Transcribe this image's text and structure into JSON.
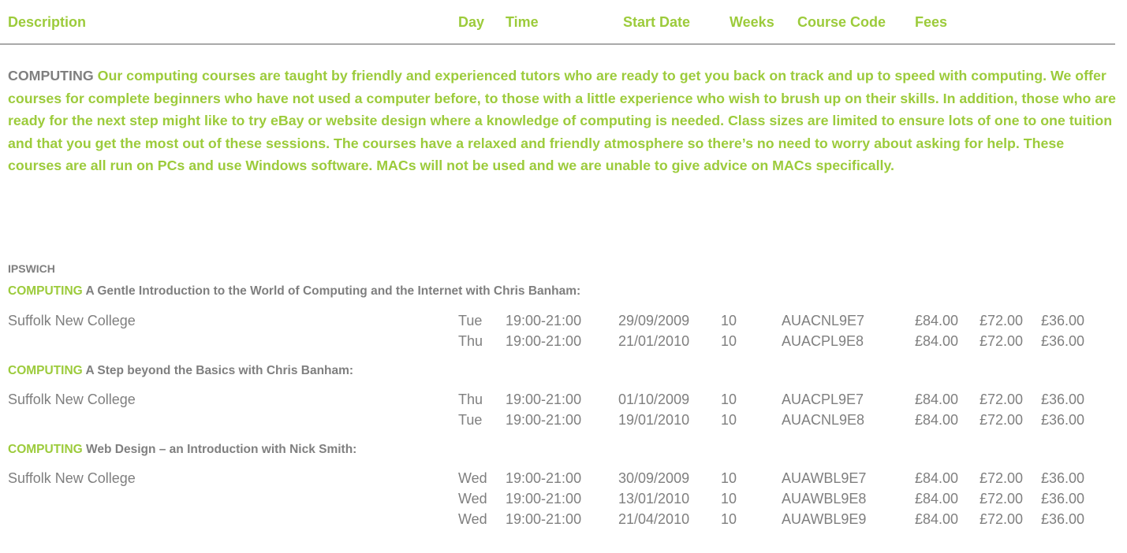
{
  "headers": {
    "description": "Description",
    "day": "Day",
    "time": "Time",
    "start_date": "Start Date",
    "weeks": "Weeks",
    "course_code": "Course Code",
    "fees": "Fees"
  },
  "intro": {
    "category": "COMPUTING",
    "text": "Our computing courses are taught by friendly and experienced tutors who are ready to get you back on track and up to speed with computing. We offer courses for complete beginners who have not used a computer before, to those with a little experience who wish to brush up on their skills. In addition, those who are ready for the next step might like to try eBay or website design where a knowledge of computing is needed. Class sizes are limited to ensure lots of one to one tuition and that you get the most out of these sessions. The courses have a relaxed and friendly atmosphere so there’s no need to worry about asking for help. These courses are all run on PCs and use Windows software. MACs will not be used and we are unable to give advice on MACs specifically."
  },
  "region": "IPSWICH",
  "courses": [
    {
      "category": "COMPUTING",
      "title": "A Gentle Introduction to the World of Computing and the Internet with Chris Banham:",
      "venue": "Suffolk New College",
      "sessions": [
        {
          "day": "Tue",
          "time": "19:00-21:00",
          "start_date": "29/09/2009",
          "weeks": "10",
          "code": "AUACNL9E7",
          "fee1": "£84.00",
          "fee2": "£72.00",
          "fee3": "£36.00"
        },
        {
          "day": "Thu",
          "time": "19:00-21:00",
          "start_date": "21/01/2010",
          "weeks": "10",
          "code": "AUACPL9E8",
          "fee1": "£84.00",
          "fee2": "£72.00",
          "fee3": "£36.00"
        }
      ]
    },
    {
      "category": "COMPUTING",
      "title": "A Step beyond the Basics with Chris Banham:",
      "venue": "Suffolk New College",
      "sessions": [
        {
          "day": "Thu",
          "time": "19:00-21:00",
          "start_date": "01/10/2009",
          "weeks": "10",
          "code": "AUACPL9E7",
          "fee1": "£84.00",
          "fee2": "£72.00",
          "fee3": "£36.00"
        },
        {
          "day": "Tue",
          "time": "19:00-21:00",
          "start_date": "19/01/2010",
          "weeks": "10",
          "code": "AUACNL9E8",
          "fee1": "£84.00",
          "fee2": "£72.00",
          "fee3": "£36.00"
        }
      ]
    },
    {
      "category": "COMPUTING",
      "title": "Web Design – an Introduction with Nick Smith:",
      "venue": "Suffolk New College",
      "sessions": [
        {
          "day": "Wed",
          "time": "19:00-21:00",
          "start_date": "30/09/2009",
          "weeks": "10",
          "code": "AUAWBL9E7",
          "fee1": "£84.00",
          "fee2": "£72.00",
          "fee3": "£36.00"
        },
        {
          "day": "Wed",
          "time": "19:00-21:00",
          "start_date": "13/01/2010",
          "weeks": "10",
          "code": "AUAWBL9E8",
          "fee1": "£84.00",
          "fee2": "£72.00",
          "fee3": "£36.00"
        },
        {
          "day": "Wed",
          "time": "19:00-21:00",
          "start_date": "21/04/2010",
          "weeks": "10",
          "code": "AUAWBL9E9",
          "fee1": "£84.00",
          "fee2": "£72.00",
          "fee3": "£36.00"
        }
      ]
    }
  ]
}
